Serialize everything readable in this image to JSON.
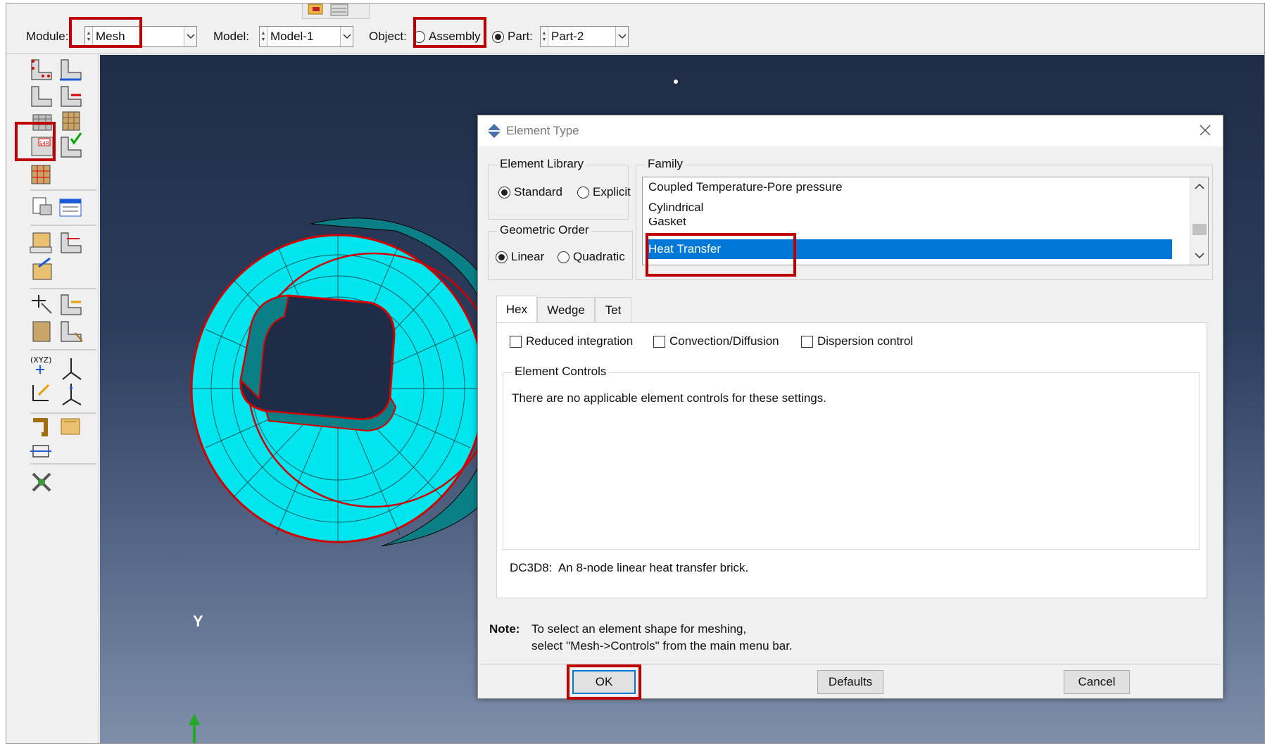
{
  "context_bar": {
    "module_label": "Module:",
    "module_value": "Mesh",
    "model_label": "Model:",
    "model_value": "Model-1",
    "object_label": "Object:",
    "assembly_label": "Assembly",
    "part_label": "Part:",
    "part_value": "Part-2",
    "object_selected": "Part"
  },
  "toolbox": {
    "icons": [
      "seed-part-icon",
      "seed-edge-icon",
      "delete-part-seeds-icon",
      "delete-edge-seeds-icon",
      "mesh-controls-icon",
      "assign-mesh-controls-icon",
      "assign-element-type-icon",
      "verify-mesh-icon",
      "mesh-part-icon",
      "delete-mesh-icon",
      "create-mesh-part-icon",
      "edit-mesh-icon",
      "create-set-icon",
      "create-surface-icon",
      "query-icon",
      "partition-face-icon",
      "partition-cell-icon",
      "datum-point-icon",
      "datum-axis-icon",
      "datum-plane-icon",
      "datum-csys-icon",
      "geometry-edit-icon",
      "virtual-topology-icon",
      "repair-icon",
      "tools-icon"
    ]
  },
  "viewport": {
    "axis_label": "Y",
    "mesh_color": "#00e5ee",
    "edge_color": "#d40000"
  },
  "dialog": {
    "title": "Element Type",
    "element_library": {
      "title": "Element Library",
      "options": [
        "Standard",
        "Explicit"
      ],
      "selected": "Standard"
    },
    "geometric_order": {
      "title": "Geometric Order",
      "options": [
        "Linear",
        "Quadratic"
      ],
      "selected": "Linear"
    },
    "family": {
      "title": "Family",
      "items": [
        "Coupled Temperature-Pore pressure",
        "Cylindrical",
        "Gasket",
        "Heat Transfer"
      ],
      "selected": "Heat Transfer"
    },
    "tabs": [
      "Hex",
      "Wedge",
      "Tet"
    ],
    "active_tab": "Hex",
    "checkboxes": [
      {
        "label": "Reduced integration",
        "checked": false
      },
      {
        "label": "Convection/Diffusion",
        "checked": false
      },
      {
        "label": "Dispersion control",
        "checked": false
      }
    ],
    "element_controls": {
      "title": "Element Controls",
      "message": "There are no applicable element controls for these settings."
    },
    "description": "DC3D8:  An 8-node linear heat transfer brick.",
    "note_label": "Note:",
    "note_line1": "To select an element shape for meshing,",
    "note_line2": "select \"Mesh->Controls\" from the main menu bar.",
    "buttons": {
      "ok": "OK",
      "defaults": "Defaults",
      "cancel": "Cancel"
    }
  },
  "highlight_color": "#c00000",
  "selection_color": "#0078d7"
}
